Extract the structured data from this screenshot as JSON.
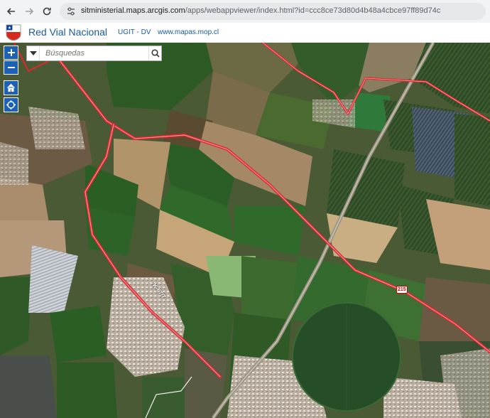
{
  "browser": {
    "url_host": "sitministerial.maps.arcgis.com",
    "url_path": "/apps/webappviewer/index.html?id=ccc8ce73d80d4b48a4cbce97ff89d74c"
  },
  "app": {
    "title": "Red Vial Nacional",
    "subtitle": "UGIT - DV",
    "link": "www.mapas.mop.cl"
  },
  "search": {
    "placeholder": "Búsquedas"
  },
  "map": {
    "road_label": "K-67/7",
    "route_shield": "215"
  },
  "colors": {
    "accent": "#1c61b5",
    "title": "#1a5aa5",
    "road": "#e0262e"
  }
}
